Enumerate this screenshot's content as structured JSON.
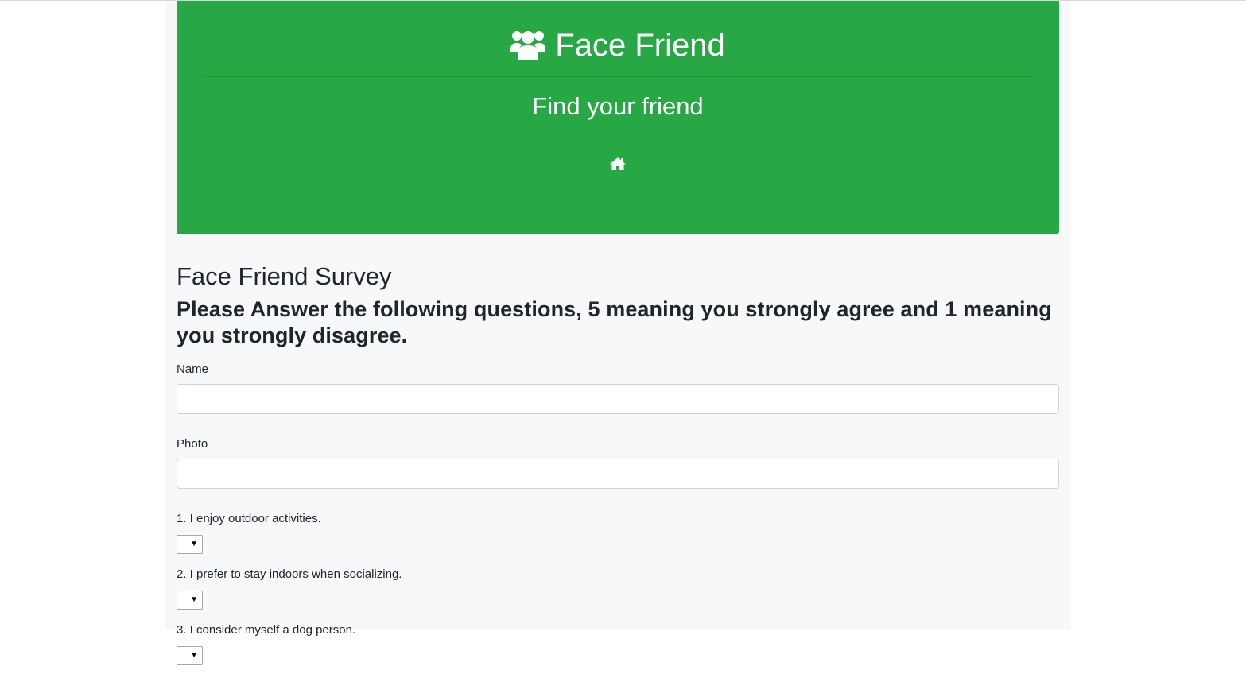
{
  "header": {
    "brand_icon": "users-icon",
    "brand_title": "Face Friend",
    "tagline": "Find your friend",
    "home_icon": "home-icon",
    "accent_color": "#28a745"
  },
  "survey": {
    "title": "Face Friend Survey",
    "subtitle": "Please Answer the following questions, 5 meaning you strongly agree and 1 meaning you strongly disagree.",
    "name_label": "Name",
    "name_value": "",
    "photo_label": "Photo",
    "photo_value": "",
    "questions": [
      {
        "label": "1. I enjoy outdoor activities.",
        "selected": ""
      },
      {
        "label": "2. I prefer to stay indoors when socializing.",
        "selected": ""
      },
      {
        "label": "3. I consider myself a dog person.",
        "selected": ""
      }
    ]
  }
}
